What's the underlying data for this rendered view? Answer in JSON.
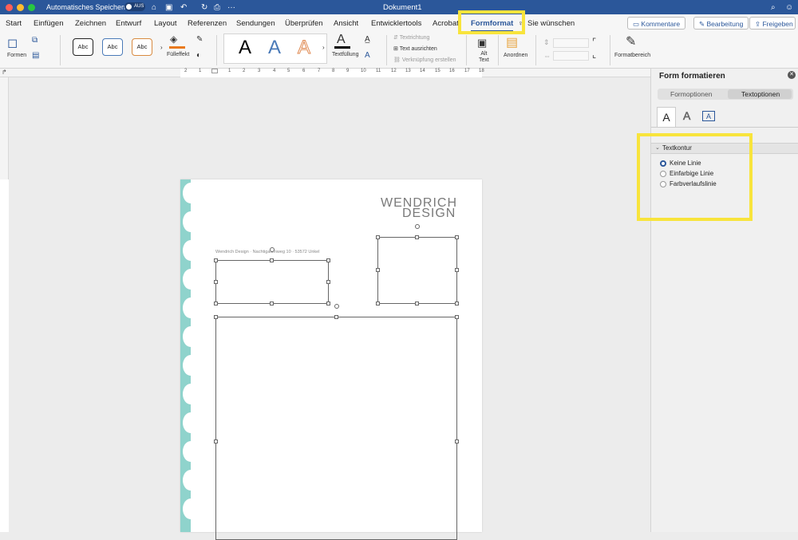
{
  "titlebar": {
    "autosave": "Automatisches Speichern",
    "toggle": "AUS",
    "doc_title": "Dokument1"
  },
  "tabs": [
    "Start",
    "Einfügen",
    "Zeichnen",
    "Entwurf",
    "Layout",
    "Referenzen",
    "Sendungen",
    "Überprüfen",
    "Ansicht",
    "Entwicklertools",
    "Acrobat",
    "Formformat",
    "Sie wünschen"
  ],
  "header_buttons": {
    "comments": "Kommentare",
    "edit": "Bearbeitung",
    "share": "Freigeben"
  },
  "ribbon": {
    "shapes": "Formen",
    "style_samples": [
      "Abc",
      "Abc",
      "Abc"
    ],
    "fill_effect": "Fülleffekt",
    "wordart": [
      "A",
      "A",
      "A"
    ],
    "text_fill": "Textfüllung",
    "text_direction": "Textrichtung",
    "align_text": "Text ausrichten",
    "create_link": "Verknüpfung erstellen",
    "alt_text": "Alt\nText",
    "arrange": "Anordnen",
    "format_pane": "Formatbereich"
  },
  "ruler": [
    "2",
    "1",
    "",
    "1",
    "2",
    "3",
    "4",
    "5",
    "6",
    "7",
    "8",
    "9",
    "10",
    "11",
    "12",
    "13",
    "14",
    "15",
    "16",
    "17",
    "18"
  ],
  "document": {
    "logo_line1": "WENDRICH",
    "logo_line2": "DESIGN",
    "sender_line": "Wendrich Design · Nachtigallenweg 10 · 53572 Unkel"
  },
  "panel": {
    "title": "Form formatieren",
    "tabs": [
      "Formoptionen",
      "Textoptionen"
    ],
    "section": "Textkontur",
    "options": [
      {
        "label": "Keine Linie",
        "selected": true
      },
      {
        "label": "Einfarbige Linie",
        "selected": false
      },
      {
        "label": "Farbverlaufslinie",
        "selected": false
      }
    ]
  },
  "colors": {
    "accent": "#2b579a",
    "highlight": "#f8e43c",
    "teal": "#8fd3cc"
  }
}
